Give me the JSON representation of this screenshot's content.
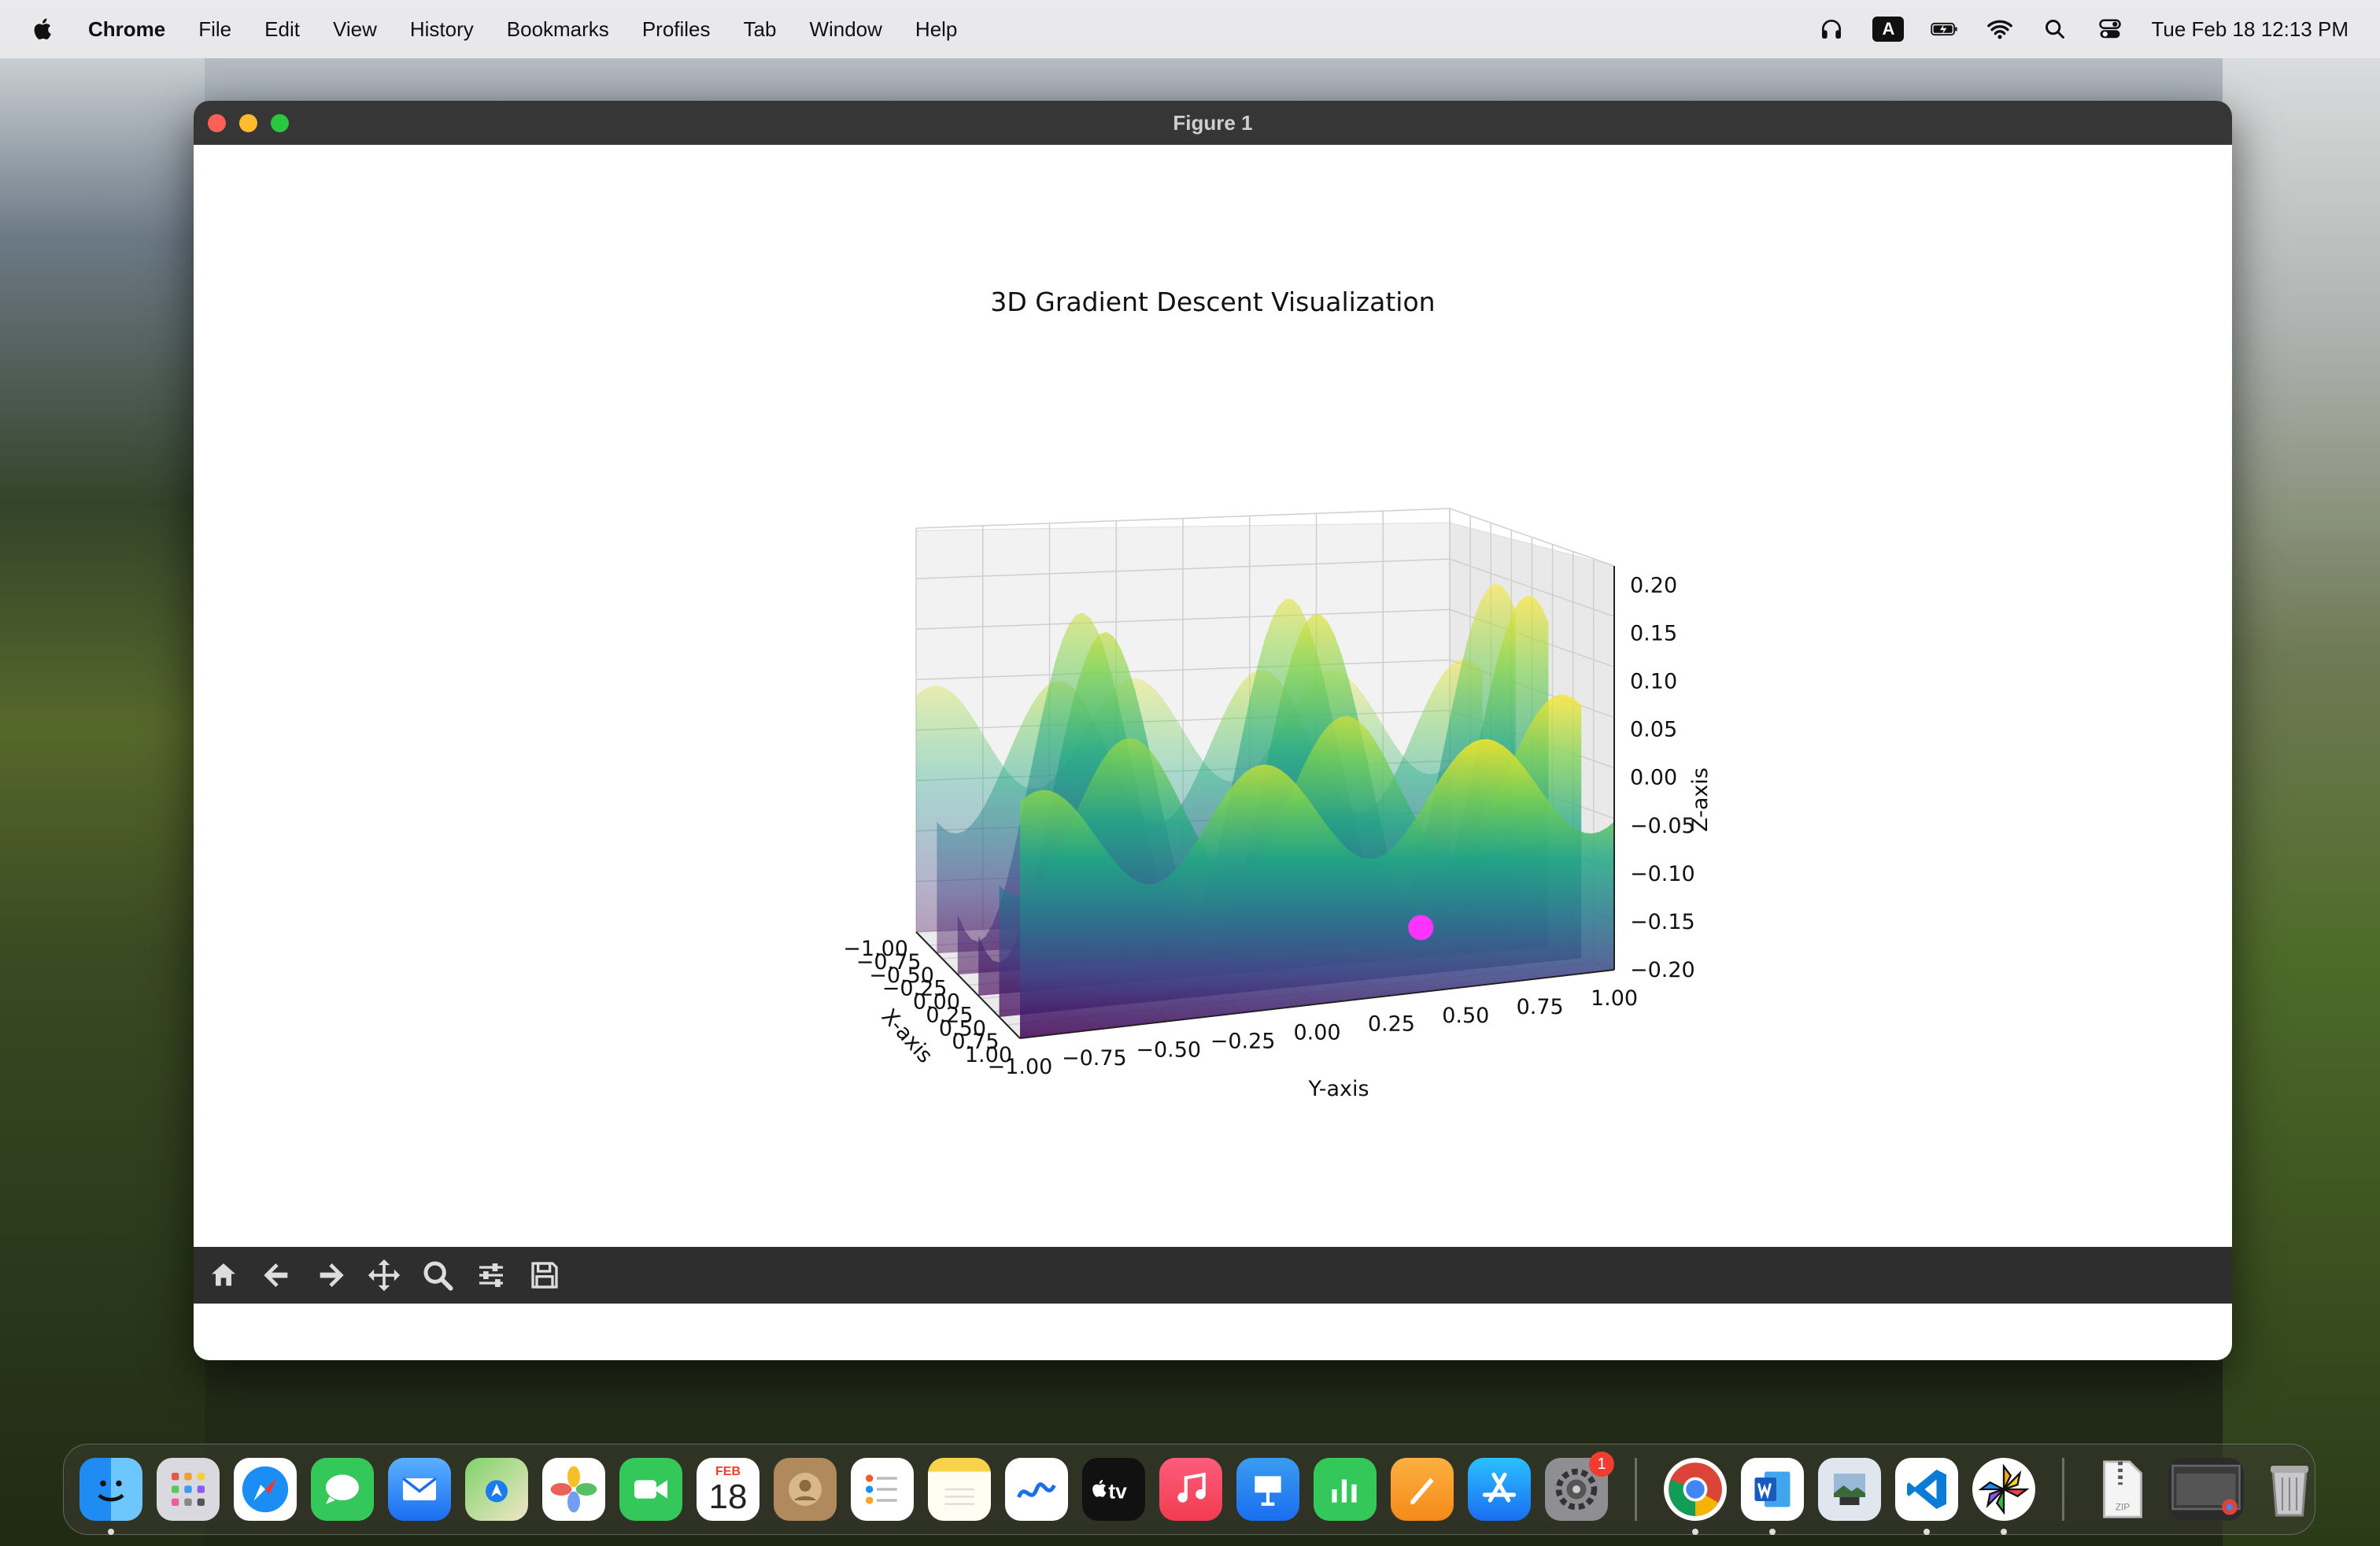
{
  "menubar": {
    "app_name": "Chrome",
    "items": [
      "File",
      "Edit",
      "View",
      "History",
      "Bookmarks",
      "Profiles",
      "Tab",
      "Window",
      "Help"
    ],
    "clock": "Tue Feb 18  12:13 PM",
    "kbd_label": "A"
  },
  "window": {
    "title": "Figure 1"
  },
  "chart_data": {
    "type": "surface3d",
    "title": "3D Gradient Descent Visualization",
    "xlabel": "X-axis",
    "ylabel": "Y-axis",
    "zlabel": "Z-axis",
    "x_ticks": [
      "−1.00",
      "−0.75",
      "−0.50",
      "−0.25",
      "0.00",
      "0.25",
      "0.50",
      "0.75",
      "1.00"
    ],
    "y_ticks": [
      "−1.00",
      "−0.75",
      "−0.50",
      "−0.25",
      "0.00",
      "0.25",
      "0.50",
      "0.75",
      "1.00"
    ],
    "z_ticks": [
      "0.20",
      "0.15",
      "0.10",
      "0.05",
      "0.00",
      "−0.05",
      "−0.10",
      "−0.15",
      "−0.20"
    ],
    "xlim": [
      -1,
      1
    ],
    "ylim": [
      -1,
      1
    ],
    "zlim": [
      -0.2,
      0.22
    ],
    "colormap": "viridis",
    "marker": {
      "color": "#ff33ff",
      "x": 0.4,
      "y": 0.5,
      "z": -0.16
    }
  },
  "toolbar": {
    "buttons": [
      "home-icon",
      "back-arrow-icon",
      "forward-arrow-icon",
      "pan-icon",
      "zoom-icon",
      "configure-subplots-icon",
      "save-icon"
    ]
  },
  "dock": {
    "calendar_month": "FEB",
    "calendar_day": "18",
    "settings_badge": "1",
    "tv_label": "tv",
    "zip_label": "ZIP"
  }
}
